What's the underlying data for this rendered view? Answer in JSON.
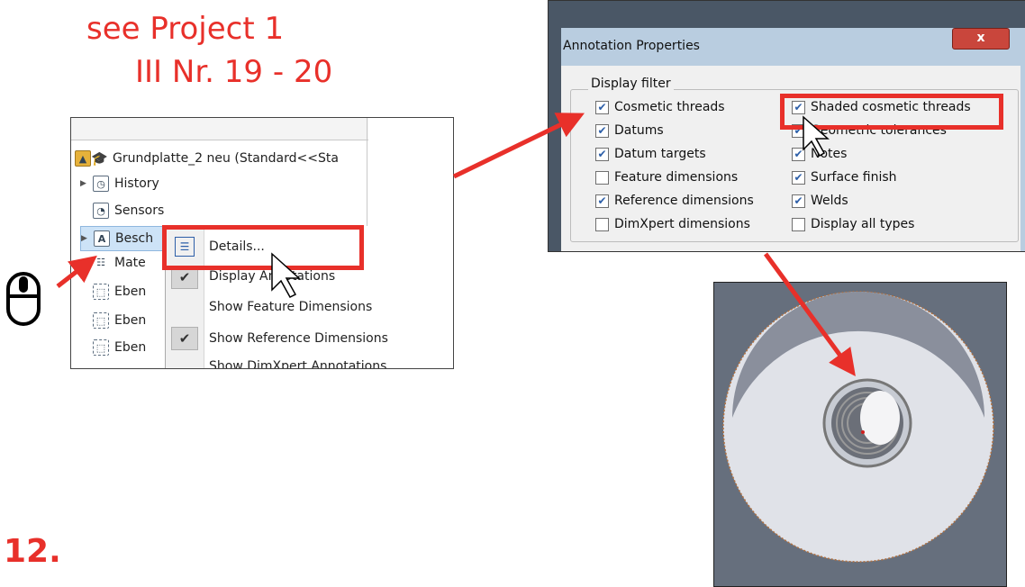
{
  "reference": {
    "line1": "see Project 1",
    "line2": "III Nr. 19 - 20"
  },
  "step_number": "12.",
  "feature_tree": {
    "items": [
      {
        "label": "Grundplatte_2 neu  (Standard<<Sta",
        "icon": "part-icon"
      },
      {
        "label": "History",
        "icon": "history-icon"
      },
      {
        "label": "Sensors",
        "icon": "sensors-icon"
      },
      {
        "label": "Besch",
        "icon": "annotations-icon"
      },
      {
        "label": "Mate",
        "icon": "material-icon"
      },
      {
        "label": "Eben",
        "icon": "plane-icon"
      },
      {
        "label": "Eben",
        "icon": "plane-icon"
      },
      {
        "label": "Eben",
        "icon": "plane-icon"
      }
    ]
  },
  "context_menu": {
    "items": [
      {
        "label": "Details...",
        "checked": false
      },
      {
        "label": "Display Annotations",
        "checked": true
      },
      {
        "label": "Show Feature Dimensions",
        "checked": false
      },
      {
        "label": "Show Reference Dimensions",
        "checked": true
      },
      {
        "label": "Show DimXpert Annotations",
        "checked": false
      }
    ]
  },
  "dialog": {
    "title": "Annotation Properties",
    "close_label": "x",
    "group_label": "Display filter",
    "left_column": [
      {
        "label": "Cosmetic threads",
        "checked": true
      },
      {
        "label": "Datums",
        "checked": true
      },
      {
        "label": "Datum targets",
        "checked": true
      },
      {
        "label": "Feature dimensions",
        "checked": false
      },
      {
        "label": "Reference dimensions",
        "checked": true
      },
      {
        "label": "DimXpert dimensions",
        "checked": false
      }
    ],
    "right_column": [
      {
        "label": "Shaded cosmetic threads",
        "checked": true
      },
      {
        "label": "Geometric tolerances",
        "checked": true
      },
      {
        "label": "Notes",
        "checked": true
      },
      {
        "label": "Surface finish",
        "checked": true
      },
      {
        "label": "Welds",
        "checked": true
      },
      {
        "label": "Display all types",
        "checked": false
      }
    ]
  },
  "colors": {
    "accent": "#e8302a",
    "viewport": "#666f7d"
  }
}
